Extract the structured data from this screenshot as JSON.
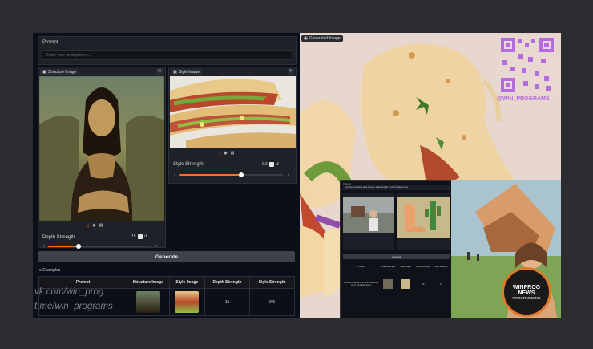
{
  "prompt": {
    "label": "Prompt",
    "placeholder": "Enter your prompt here..."
  },
  "structure_image": {
    "label": "Structure Image"
  },
  "style_image": {
    "label": "Style Image"
  },
  "depth_strength": {
    "label": "Depth Strength",
    "value": "15",
    "min": "0",
    "max": "50",
    "fraction": 0.3
  },
  "style_strength": {
    "label": "Style Strength",
    "value": "0.6",
    "min": "0",
    "max": "1",
    "fraction": 0.6
  },
  "generate_label": "Generate",
  "examples": {
    "label": "Examples",
    "columns": [
      "Prompt",
      "Structure Image",
      "Style Image",
      "Depth Strength",
      "Style Strength"
    ],
    "row": {
      "depth": "15",
      "style": "0.6"
    }
  },
  "generated": {
    "label": "Generated Image",
    "qr_handle": "@WIN_PROGRAMS"
  },
  "inset": {
    "prompt_text": "a person looking at a house, standing far in the background",
    "generate_label": "Generate",
    "columns": [
      "Prompt",
      "Structure Image",
      "Style Image",
      "Depth Strength",
      "Style Strength"
    ],
    "row_prompt": "a person looking at a house standing far in the background",
    "row_depth": "15",
    "row_style": "0.6"
  },
  "badge": {
    "line1": "WINPROG",
    "line2": "NEWS",
    "line3": "PROGRAMMING"
  },
  "watermark": {
    "line1": "vk.com/win_prog",
    "line2": "t.me/win_programs"
  },
  "colors": {
    "accent": "#f97316",
    "panel": "#1f2128",
    "app_bg": "#0b0f19"
  }
}
